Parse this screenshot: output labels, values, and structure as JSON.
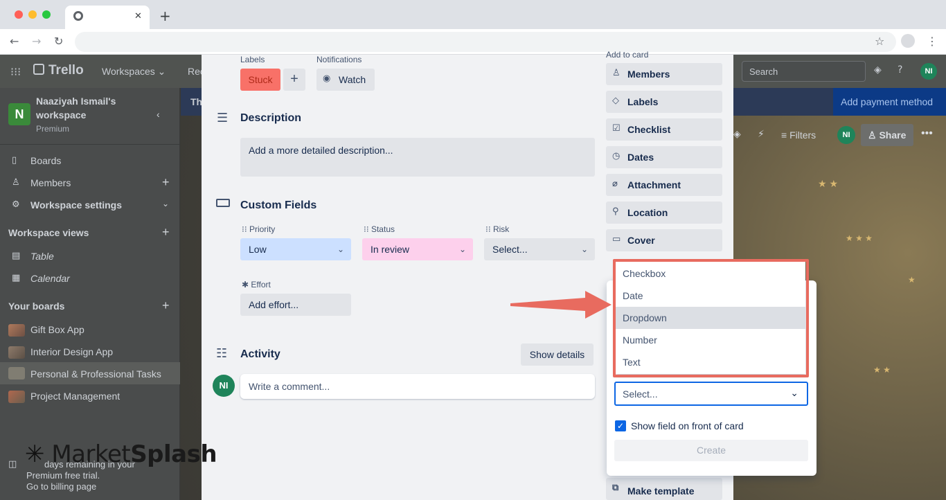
{
  "browser": {
    "new_tab_symbol": "+",
    "close_tab_symbol": "✕"
  },
  "trello": {
    "logo": "Trello",
    "nav": {
      "workspaces": "Workspaces",
      "recent": "Rec"
    },
    "search_placeholder": "Search",
    "avatar": "NI",
    "workspace_name_line1": "Naaziyah Ismail's",
    "workspace_name_line2": "workspace",
    "workspace_plan": "Premium",
    "workspace_initial": "N",
    "sidebar": {
      "boards": "Boards",
      "members": "Members",
      "settings": "Workspace settings",
      "views_header": "Workspace views",
      "table": "Table",
      "calendar": "Calendar",
      "your_boards": "Your boards",
      "board_list": [
        "Gift Box App",
        "Interior Design App",
        "Personal & Professional Tasks",
        "Project Management"
      ]
    },
    "banner_text": "Th",
    "payment_button": "Add payment method",
    "board_header": {
      "filters": "Filters",
      "share": "Share",
      "avatar": "NI"
    },
    "trial": {
      "line1": "days remaining in your",
      "line2": "Premium free trial.",
      "line3": "Go to billing page"
    },
    "watermark": {
      "part1": "Market",
      "part2": "Splash"
    }
  },
  "card": {
    "labels_heading": "Labels",
    "label_stuck": "Stuck",
    "add_label": "+",
    "notifications_heading": "Notifications",
    "watch": "Watch",
    "description_title": "Description",
    "description_placeholder": "Add a more detailed description...",
    "custom_fields_title": "Custom Fields",
    "fields": {
      "priority": {
        "label": "Priority",
        "value": "Low"
      },
      "status": {
        "label": "Status",
        "value": "In review"
      },
      "risk": {
        "label": "Risk",
        "value": "Select..."
      },
      "effort": {
        "label": "Effort",
        "value": "Add effort..."
      }
    },
    "activity_title": "Activity",
    "show_details": "Show details",
    "comment_avatar": "NI",
    "comment_placeholder": "Write a comment...",
    "add_to_card": "Add to card",
    "side_buttons": [
      "Members",
      "Labels",
      "Checklist",
      "Dates",
      "Attachment",
      "Location",
      "Cover"
    ],
    "make_template": "Make template"
  },
  "popover": {
    "options": [
      "Checkbox",
      "Date",
      "Dropdown",
      "Number",
      "Text"
    ],
    "selected_option": "Dropdown",
    "type_select_placeholder": "Select...",
    "show_on_front_label": "Show field on front of card",
    "show_on_front_checked": true,
    "create_button": "Create"
  },
  "colors": {
    "stuck_label": "#f87168",
    "priority_low": "#cce0ff",
    "status_review": "#fdd0ec",
    "highlight": "#e86b5f",
    "avatar_green": "#1f845a"
  }
}
